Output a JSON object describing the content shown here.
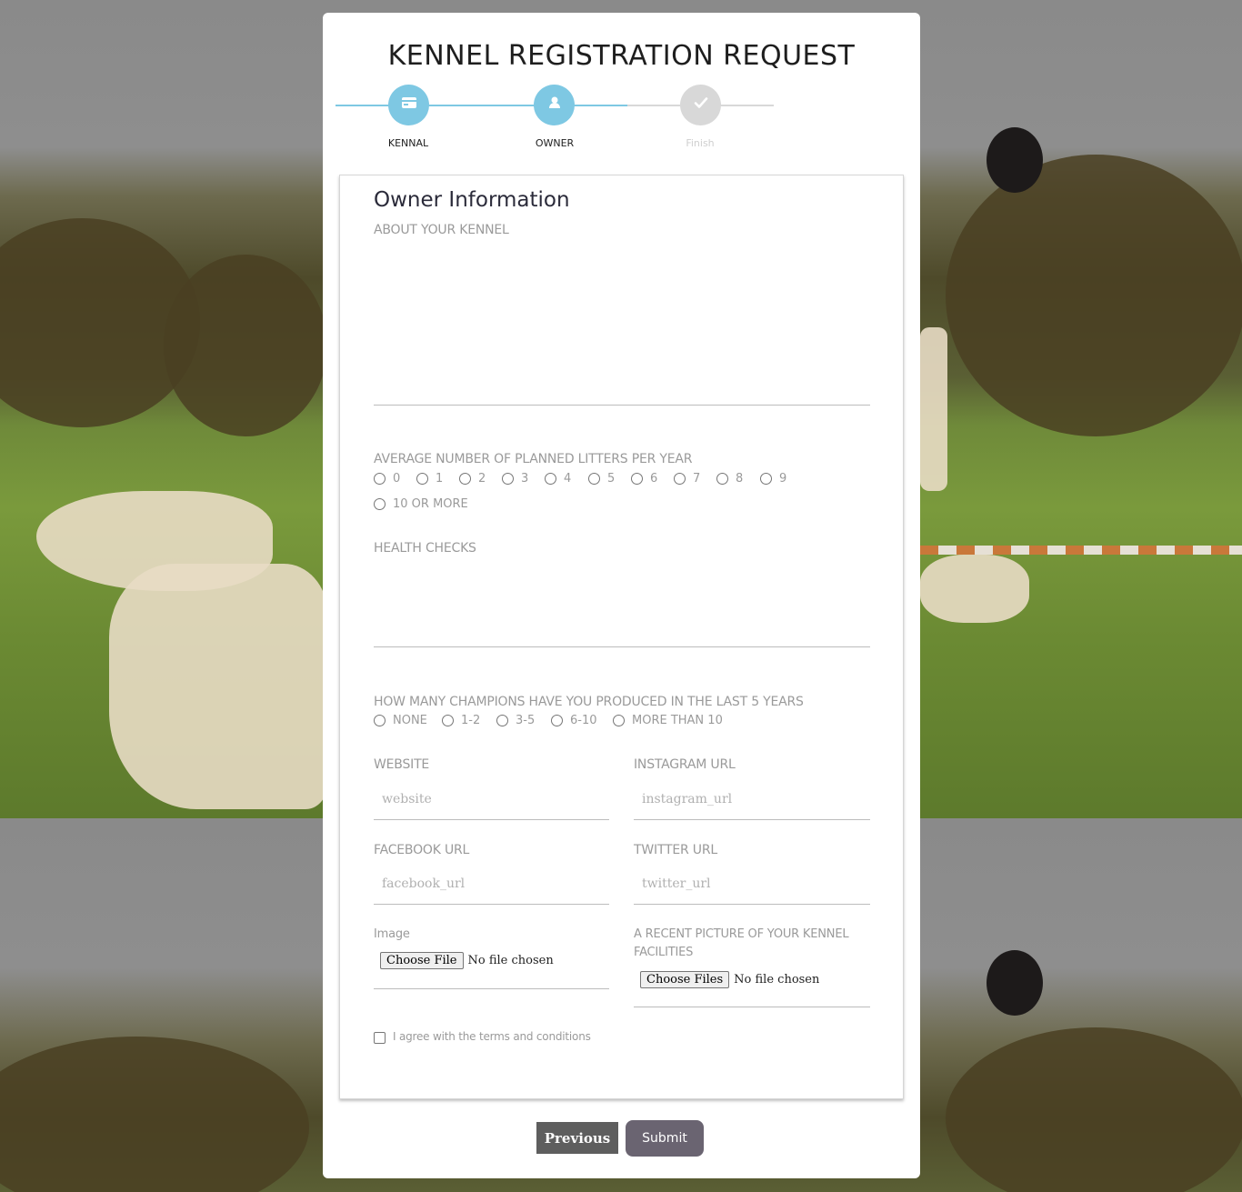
{
  "page": {
    "title": "KENNEL REGISTRATION REQUEST"
  },
  "stepper": {
    "steps": [
      {
        "label": "KENNAL",
        "icon": "credit-card-icon",
        "state": "complete"
      },
      {
        "label": "OWNER",
        "icon": "user-icon",
        "state": "active"
      },
      {
        "label": "Finish",
        "icon": "check-icon",
        "state": "pending"
      }
    ],
    "colors": {
      "active": "#7ec8e3",
      "pending": "#d8d8d8"
    }
  },
  "form": {
    "section_title": "Owner Information",
    "about_label": "ABOUT YOUR KENNEL",
    "litters_label": "AVERAGE NUMBER OF PLANNED LITTERS PER YEAR",
    "litters_options": [
      "0",
      "1",
      "2",
      "3",
      "4",
      "5",
      "6",
      "7",
      "8",
      "9",
      "10 OR MORE"
    ],
    "health_label": "HEALTH CHECKS",
    "champions_label": "HOW MANY CHAMPIONS HAVE YOU PRODUCED IN THE LAST 5 YEARS",
    "champions_options": [
      "NONE",
      "1-2",
      "3-5",
      "6-10",
      "MORE THAN 10"
    ],
    "website_label": "WEBSITE",
    "website_placeholder": "website",
    "instagram_label": "INSTAGRAM URL",
    "instagram_placeholder": "instagram_url",
    "facebook_label": "FACEBOOK URL",
    "facebook_placeholder": "facebook_url",
    "twitter_label": "TWITTER URL",
    "twitter_placeholder": "twitter_url",
    "image_label": "Image",
    "image_button": "Choose File",
    "image_status": "No file chosen",
    "facilities_label_line1": "A RECENT PICTURE OF YOUR KENNEL",
    "facilities_label_line2": "FACILITIES",
    "facilities_button": "Choose Files",
    "facilities_status": "No file chosen",
    "terms_label": "I agree with the terms and conditions"
  },
  "buttons": {
    "previous": "Previous",
    "submit": "Submit"
  }
}
